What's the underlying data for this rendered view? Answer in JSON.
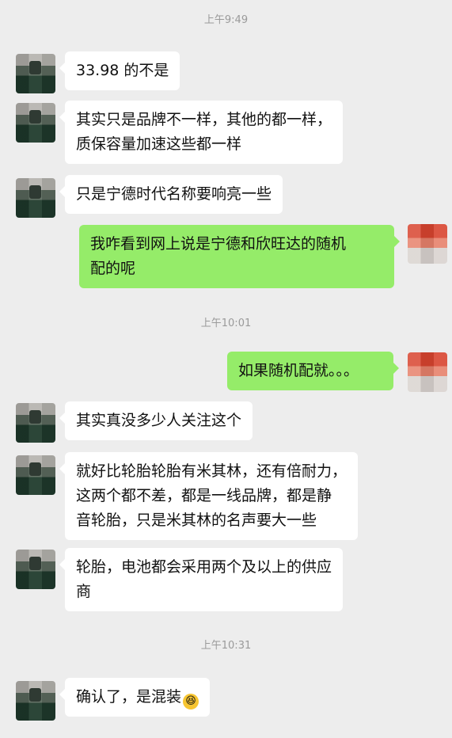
{
  "timestamps": [
    "上午9:49",
    "上午10:01",
    "上午10:31"
  ],
  "messages": [
    {
      "side": "in",
      "lines": [
        "33.98 的不是"
      ]
    },
    {
      "side": "in",
      "lines": [
        "其实只是品牌不一样，其他的都一样，",
        "质保容量加速这些都一样"
      ]
    },
    {
      "side": "in",
      "lines": [
        "只是宁德时代名称要响亮一些"
      ]
    },
    {
      "side": "out",
      "lines": [
        "我咋看到网上说是宁德和欣旺达的随机",
        "配的呢"
      ]
    },
    {
      "side": "out",
      "lines": [
        "如果随机配就。。。"
      ]
    },
    {
      "side": "in",
      "lines": [
        "其实真没多少人关注这个"
      ]
    },
    {
      "side": "in",
      "lines": [
        "就好比轮胎轮胎有米其林，还有倍耐力，",
        "这两个都不差，都是一线品牌，都是静",
        "音轮胎，只是米其林的名声要大一些"
      ]
    },
    {
      "side": "in",
      "lines": [
        "轮胎，电池都会采用两个及以上的供应",
        "商"
      ]
    },
    {
      "side": "in",
      "lines": [
        "确认了，是混装"
      ]
    }
  ],
  "icons": {
    "avatar_left": "contact-avatar",
    "avatar_right": "self-avatar",
    "emoji": "laughing-emoji"
  },
  "colors": {
    "background": "#ededed",
    "incoming_bubble": "#ffffff",
    "outgoing_bubble": "#95ec69",
    "timestamp_text": "#9a9a9a"
  }
}
